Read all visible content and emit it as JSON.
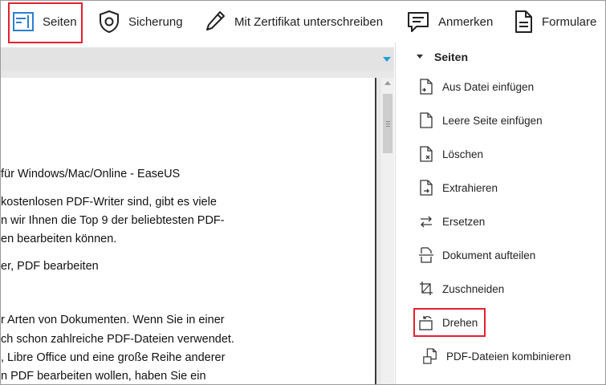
{
  "toolbar": {
    "pages": "Seiten",
    "security": "Sicherung",
    "sign": "Mit Zertifikat unterschreiben",
    "comment": "Anmerken",
    "forms": "Formulare"
  },
  "document": {
    "lines": [
      "für Windows/Mac/Online - EaseUS",
      "kostenlosen PDF-Writer sind, gibt es viele",
      "n wir Ihnen die Top 9 der beliebtesten PDF-",
      "en bearbeiten können.",
      "er, PDF bearbeiten",
      "r Arten von Dokumenten. Wenn Sie in einer",
      "ch schon zahlreiche PDF-Dateien verwendet.",
      ", Libre Office und eine große Reihe anderer",
      "n PDF bearbeiten wollen, haben Sie ein"
    ]
  },
  "panel": {
    "title": "Seiten",
    "items": [
      {
        "label": "Aus Datei einfügen",
        "icon": "insert-from-file-icon"
      },
      {
        "label": "Leere Seite einfügen",
        "icon": "blank-page-icon"
      },
      {
        "label": "Löschen",
        "icon": "delete-page-icon"
      },
      {
        "label": "Extrahieren",
        "icon": "extract-page-icon"
      },
      {
        "label": "Ersetzen",
        "icon": "replace-page-icon"
      },
      {
        "label": "Dokument aufteilen",
        "icon": "split-document-icon"
      },
      {
        "label": "Zuschneiden",
        "icon": "crop-icon"
      },
      {
        "label": "Drehen",
        "icon": "rotate-icon"
      },
      {
        "label": "PDF-Dateien kombinieren",
        "icon": "combine-pdf-icon"
      }
    ]
  },
  "colors": {
    "highlight": "#e5202e",
    "accent_arrow": "#1ea0d8",
    "pages_icon": "#2a7fd4"
  }
}
